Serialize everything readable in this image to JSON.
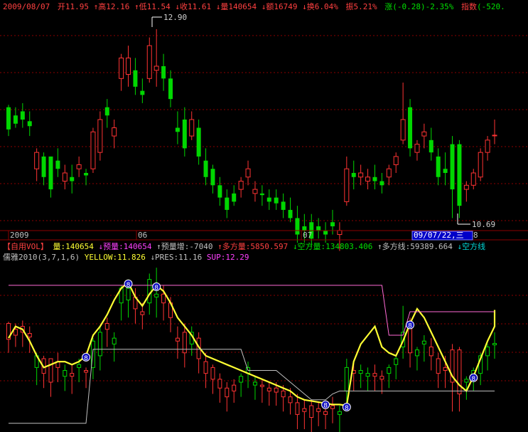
{
  "info_bar": {
    "date": "2009/08/07",
    "open_label": "开",
    "open": "11.95",
    "high_label": "↑高",
    "high": "12.16",
    "low_label": "↑低",
    "low": "11.54",
    "close_label": "↓收",
    "close": "11.61",
    "vol_label": "↓量",
    "vol": "140654",
    "amount_label": "↓额",
    "amount": "16749",
    "turn_label": "↓换",
    "turn": "6.04%",
    "amp_label": "振",
    "amp": "5.21%",
    "chg_label": "涨",
    "chg": "(-0.28)-2.35%",
    "index_label": "指数",
    "index": "(-520."
  },
  "vol_bar": {
    "name": "【自用VOL】",
    "v1": "量:140654",
    "v2": "↓预量:140654",
    "v3": "↑预量增:-7040",
    "v4": "↑多方量:5850.597",
    "v5": "↓空方量:134803.406",
    "v6": "↑多方线:59389.664",
    "v7": "↓空方线"
  },
  "indicator_bar": {
    "name": "儒雅2010(3,7,1,6)",
    "yellow": "YELLOW:11.826",
    "pres": "↓PRES:11.16",
    "sup": "SUP:12.29"
  },
  "axis": {
    "labels": [
      "2009",
      "06",
      "07",
      "09/07/22,三",
      "8"
    ]
  },
  "colors": {
    "up": "#ff3333",
    "down": "#00d700",
    "yellow": "#ffff33",
    "pink_line": "#ff6ad5",
    "gray_line": "#c0c0c0",
    "grid": "#8b0000",
    "text_red": "#ff4040",
    "text_cyan": "#00d8d8",
    "text_yellow": "#ffff33",
    "text_magenta": "#ff40ff",
    "text_green": "#00e000"
  },
  "chart_data": [
    {
      "type": "candlestick",
      "title": "",
      "price_range": [
        10.5,
        13.1
      ],
      "annotations": {
        "max": "12.90",
        "min": "10.69"
      },
      "ohlc": [
        [
          11.95,
          11.98,
          11.6,
          11.68
        ],
        [
          11.85,
          11.95,
          11.7,
          11.75
        ],
        [
          11.9,
          12.0,
          11.7,
          11.8
        ],
        [
          11.78,
          11.9,
          11.6,
          11.72
        ],
        [
          11.2,
          11.45,
          11.05,
          11.4
        ],
        [
          11.35,
          11.4,
          11.0,
          11.1
        ],
        [
          11.35,
          11.35,
          10.85,
          10.95
        ],
        [
          11.3,
          11.45,
          11.1,
          11.2
        ],
        [
          11.05,
          11.25,
          10.95,
          11.15
        ],
        [
          11.1,
          11.25,
          10.9,
          11.05
        ],
        [
          11.2,
          11.35,
          11.1,
          11.25
        ],
        [
          11.15,
          11.2,
          11.0,
          11.12
        ],
        [
          11.2,
          11.7,
          11.15,
          11.65
        ],
        [
          11.4,
          11.9,
          11.3,
          11.8
        ],
        [
          11.95,
          12.05,
          11.7,
          11.85
        ],
        [
          11.6,
          11.8,
          11.45,
          11.7
        ],
        [
          12.3,
          12.6,
          12.15,
          12.55
        ],
        [
          12.35,
          12.7,
          12.2,
          12.55
        ],
        [
          12.4,
          12.55,
          12.1,
          12.2
        ],
        [
          12.15,
          12.3,
          12.0,
          12.1
        ],
        [
          12.3,
          12.8,
          12.25,
          12.7
        ],
        [
          12.4,
          12.9,
          12.2,
          12.45
        ],
        [
          12.45,
          12.6,
          12.15,
          12.3
        ],
        [
          12.3,
          12.4,
          11.95,
          12.05
        ],
        [
          11.7,
          11.9,
          11.5,
          11.65
        ],
        [
          11.8,
          11.95,
          11.35,
          11.45
        ],
        [
          11.6,
          11.9,
          11.55,
          11.8
        ],
        [
          11.7,
          11.8,
          11.25,
          11.35
        ],
        [
          11.3,
          11.45,
          11.0,
          11.1
        ],
        [
          11.2,
          11.25,
          10.9,
          11.0
        ],
        [
          11.0,
          11.1,
          10.75,
          10.85
        ],
        [
          10.85,
          10.95,
          10.6,
          10.7
        ],
        [
          10.9,
          11.0,
          10.75,
          10.8
        ],
        [
          10.95,
          11.1,
          10.85,
          11.05
        ],
        [
          11.1,
          11.3,
          11.0,
          11.2
        ],
        [
          10.9,
          11.05,
          10.8,
          10.95
        ],
        [
          10.9,
          11.0,
          10.75,
          10.88
        ],
        [
          10.85,
          10.95,
          10.7,
          10.8
        ],
        [
          10.85,
          10.95,
          10.7,
          10.78
        ],
        [
          10.8,
          10.9,
          10.6,
          10.7
        ],
        [
          10.7,
          10.85,
          10.55,
          10.6
        ],
        [
          10.6,
          10.75,
          10.3,
          10.4
        ],
        [
          10.5,
          10.65,
          10.3,
          10.45
        ],
        [
          10.55,
          10.65,
          10.25,
          10.35
        ],
        [
          10.5,
          10.6,
          10.35,
          10.45
        ],
        [
          10.45,
          10.55,
          10.3,
          10.4
        ],
        [
          10.55,
          10.7,
          10.4,
          10.5
        ],
        [
          10.4,
          10.55,
          10.2,
          10.45
        ],
        [
          10.8,
          11.35,
          10.75,
          11.2
        ],
        [
          11.15,
          11.3,
          10.95,
          11.1
        ],
        [
          11.1,
          11.25,
          11.0,
          11.15
        ],
        [
          11.05,
          11.2,
          10.95,
          11.1
        ],
        [
          11.1,
          11.25,
          10.95,
          11.05
        ],
        [
          11.05,
          11.15,
          10.9,
          11.0
        ],
        [
          11.1,
          11.25,
          11.0,
          11.2
        ],
        [
          11.25,
          11.4,
          11.15,
          11.35
        ],
        [
          11.55,
          12.25,
          11.5,
          11.8
        ],
        [
          11.95,
          12.05,
          11.35,
          11.45
        ],
        [
          11.4,
          11.55,
          11.3,
          11.5
        ],
        [
          11.6,
          11.75,
          11.45,
          11.65
        ],
        [
          11.55,
          11.7,
          11.3,
          11.4
        ],
        [
          11.35,
          11.45,
          11.0,
          11.1
        ],
        [
          11.2,
          11.4,
          11.0,
          11.15
        ],
        [
          11.5,
          11.6,
          10.6,
          10.95
        ],
        [
          11.5,
          11.55,
          10.6,
          10.75
        ],
        [
          10.95,
          11.05,
          10.8,
          11.0
        ],
        [
          11.0,
          11.2,
          10.95,
          11.15
        ],
        [
          11.1,
          11.45,
          11.05,
          11.4
        ],
        [
          11.4,
          11.6,
          11.3,
          11.55
        ],
        [
          11.61,
          11.8,
          11.5,
          11.61
        ]
      ]
    },
    {
      "type": "line",
      "title": "儒雅2010(3,7,1,6)",
      "series": [
        {
          "name": "YELLOW",
          "values": [
            11.35,
            11.55,
            11.5,
            11.3,
            11.05,
            10.85,
            10.9,
            10.95,
            10.95,
            10.9,
            10.95,
            11.05,
            11.4,
            11.55,
            11.75,
            12.0,
            12.2,
            12.3,
            12.05,
            11.9,
            12.1,
            12.25,
            12.15,
            11.95,
            11.7,
            11.55,
            11.4,
            11.2,
            11.05,
            11.0,
            10.95,
            10.9,
            10.85,
            10.8,
            10.75,
            10.7,
            10.65,
            10.6,
            10.55,
            10.5,
            10.45,
            10.35,
            10.3,
            10.28,
            10.26,
            10.24,
            10.22,
            10.22,
            10.2,
            10.95,
            11.25,
            11.4,
            11.55,
            11.2,
            11.1,
            11.05,
            11.3,
            11.6,
            11.85,
            11.7,
            11.45,
            11.2,
            10.95,
            10.7,
            10.55,
            10.45,
            10.7,
            11.0,
            11.3,
            11.55,
            11.83
          ]
        },
        {
          "name": "PRES",
          "values": [
            12.25,
            12.25,
            12.25,
            12.25,
            12.25,
            12.25,
            12.25,
            12.25,
            12.25,
            12.25,
            12.25,
            12.25,
            12.25,
            12.25,
            12.25,
            12.25,
            12.25,
            12.25,
            12.25,
            12.25,
            12.25,
            12.25,
            12.25,
            12.25,
            12.25,
            12.25,
            12.25,
            12.25,
            12.25,
            12.25,
            12.25,
            12.25,
            12.25,
            12.25,
            12.25,
            12.25,
            12.25,
            12.25,
            12.25,
            12.25,
            12.25,
            12.25,
            12.25,
            12.25,
            12.25,
            12.25,
            12.25,
            12.25,
            12.25,
            12.25,
            12.25,
            12.25,
            12.25,
            12.25,
            11.4,
            11.4,
            11.4,
            11.8,
            11.8,
            11.8,
            11.8,
            11.8,
            11.8,
            11.8,
            11.8,
            11.8,
            11.8,
            11.8,
            11.8,
            11.8,
            11.8
          ]
        },
        {
          "name": "SUP",
          "values": [
            9.9,
            9.9,
            9.9,
            9.9,
            9.9,
            9.9,
            9.9,
            9.9,
            9.9,
            9.9,
            9.9,
            9.9,
            11.16,
            11.16,
            11.16,
            11.16,
            11.16,
            11.16,
            11.16,
            11.16,
            11.16,
            11.16,
            11.16,
            11.16,
            11.16,
            11.16,
            11.16,
            11.16,
            11.16,
            11.16,
            11.16,
            11.16,
            11.16,
            11.16,
            10.8,
            10.8,
            10.8,
            10.8,
            10.8,
            10.7,
            10.6,
            10.5,
            10.4,
            10.3,
            10.3,
            10.3,
            10.4,
            10.45,
            10.45,
            10.45,
            10.45,
            10.45,
            10.45,
            10.45,
            10.45,
            10.45,
            10.45,
            10.45,
            10.45,
            10.45,
            10.45,
            10.45,
            10.45,
            10.45,
            10.45,
            10.45,
            10.45,
            10.45,
            10.45,
            10.45,
            10.45
          ]
        }
      ],
      "markers": [
        {
          "index": 11,
          "label": "8"
        },
        {
          "index": 17,
          "label": "8"
        },
        {
          "index": 21,
          "label": "8"
        },
        {
          "index": 45,
          "label": "8"
        },
        {
          "index": 48,
          "label": "8"
        },
        {
          "index": 57,
          "label": "8"
        },
        {
          "index": 66,
          "label": "8"
        }
      ]
    }
  ]
}
